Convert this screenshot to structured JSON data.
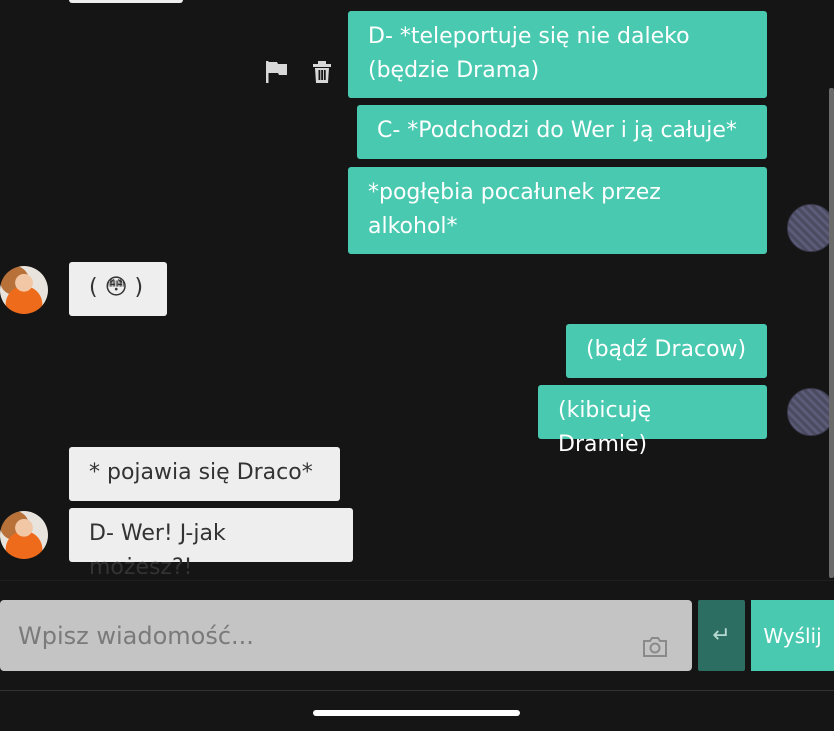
{
  "messages": [
    {
      "side": "me",
      "text": "D- *teleportuje się nie daleko\n(będzie Drama)"
    },
    {
      "side": "me",
      "text": "C- *Podchodzi do Wer i ją całuje*"
    },
    {
      "side": "me",
      "text": "*pogłębia pocałunek przez\nalkohol*"
    },
    {
      "side": "other",
      "text": "( 😳 )"
    },
    {
      "side": "me",
      "text": "(bądź Dracow)"
    },
    {
      "side": "me",
      "text": "(kibicuję Dramie)"
    },
    {
      "side": "other",
      "text": "* pojawia się Draco*"
    },
    {
      "side": "other",
      "text": "D- Wer! J-jak możesz?!"
    }
  ],
  "message_actions": {
    "icons": [
      "flag-icon",
      "trash-icon"
    ]
  },
  "composer": {
    "placeholder": "Wpisz wiadomość...",
    "enter_symbol": "↵",
    "send_label": "Wyślij"
  },
  "colors": {
    "background": "#151515",
    "my_bubble": "#48c9b0",
    "other_bubble": "#eeeeee",
    "enter_button": "#2d6e62",
    "input": "#c4c4c4"
  }
}
